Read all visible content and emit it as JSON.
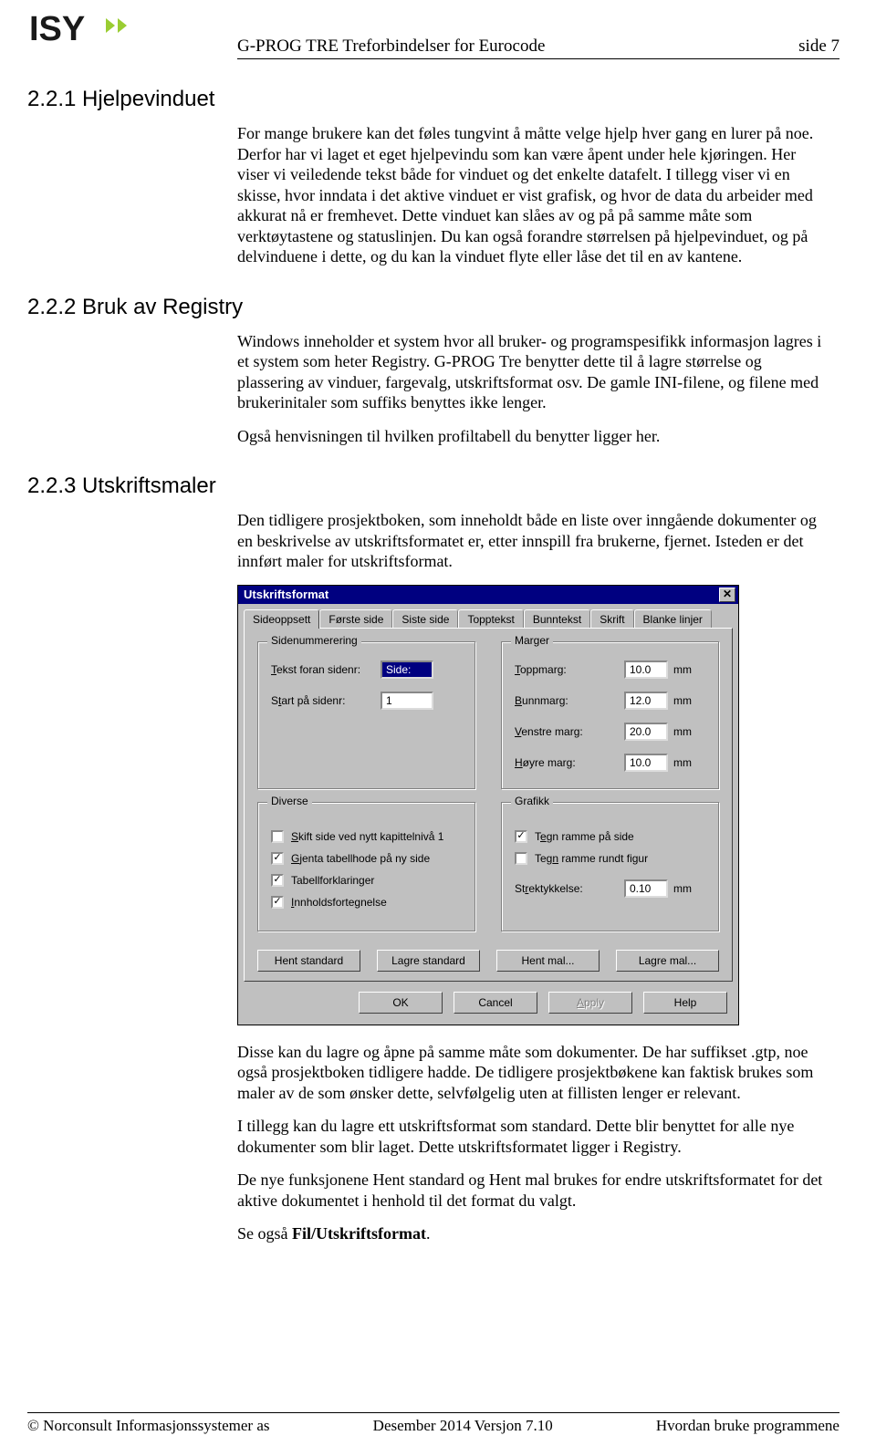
{
  "header": {
    "title": "G-PROG TRE Treforbindelser for Eurocode",
    "page": "side 7"
  },
  "sections": {
    "s1": {
      "title": "2.2.1 Hjelpevinduet",
      "p1": "For mange brukere kan det føles tungvint å måtte velge hjelp hver gang en lurer på noe. Derfor har vi laget et eget hjelpevindu som kan være åpent under hele kjøringen. Her viser vi veiledende tekst både for vinduet og det enkelte datafelt. I tillegg viser vi en skisse, hvor inndata i det aktive vinduet er vist grafisk, og hvor de data du arbeider med akkurat nå er fremhevet. Dette vinduet kan slåes av og på på samme måte som verktøytastene og statuslinjen. Du kan også forandre størrelsen på hjelpevinduet, og på delvinduene i dette, og du kan la vinduet flyte eller låse det til en av kantene."
    },
    "s2": {
      "title": "2.2.2 Bruk av Registry",
      "p1": "Windows inneholder et system hvor all bruker- og programspesifikk informasjon lagres i et system som heter Registry. G-PROG Tre benytter dette til å lagre størrelse og plassering av vinduer, fargevalg, utskriftsformat osv. De gamle INI-filene, og filene med brukerinitaler som suffiks benyttes ikke lenger.",
      "p2": "Også henvisningen til hvilken profiltabell du benytter ligger her."
    },
    "s3": {
      "title": "2.2.3 Utskriftsmaler",
      "p1": "Den tidligere prosjektboken, som inneholdt både en liste over inngående dokumenter og en beskrivelse av utskriftsformatet er, etter innspill fra brukerne, fjernet. Isteden er det innført maler for utskriftsformat.",
      "p2": "Disse kan du lagre og åpne på samme måte som dokumenter. De har suffikset .gtp, noe også prosjektboken tidligere hadde. De tidligere prosjektbøkene kan faktisk brukes som maler av de som ønsker dette, selvfølgelig uten at fillisten lenger er relevant.",
      "p3": "I tillegg kan du lagre ett utskriftsformat som standard. Dette blir benyttet for alle nye dokumenter som blir laget. Dette utskriftsformatet ligger i Registry.",
      "p4": "De nye funksjonene Hent standard og Hent mal brukes for endre utskriftsformatet for det aktive dokumentet i henhold til det format du valgt.",
      "p5a": "Se også ",
      "p5b": "Fil/Utskriftsformat",
      "p5c": "."
    }
  },
  "dialog": {
    "title": "Utskriftsformat",
    "tabs": [
      "Sideoppsett",
      "Første side",
      "Siste side",
      "Topptekst",
      "Bunntekst",
      "Skrift",
      "Blanke linjer"
    ],
    "pagegroup": {
      "title": "Sidenummerering",
      "l1": "Tekst foran sidenr:",
      "v1": "Side:",
      "l2": "Start på sidenr:",
      "v2": "1"
    },
    "margingroup": {
      "title": "Marger",
      "l1": "Toppmarg:",
      "v1": "10.0",
      "l2": "Bunnmarg:",
      "v2": "12.0",
      "l3": "Venstre marg:",
      "v3": "20.0",
      "l4": "Høyre marg:",
      "v4": "10.0",
      "unit": "mm"
    },
    "divgroup": {
      "title": "Diverse",
      "c1": "Skift side ved nytt kapittelnivå 1",
      "c2": "Gjenta tabellhode på ny side",
      "c3": "Tabellforklaringer",
      "c4": "Innholdsfortegnelse"
    },
    "gfxgroup": {
      "title": "Grafikk",
      "c1": "Tegn ramme på side",
      "c2": "Tegn ramme rundt figur",
      "l3": "Strektykkelse:",
      "v3": "0.10"
    },
    "buttons": {
      "hentstd": "Hent standard",
      "lagrestd": "Lagre standard",
      "hentmal": "Hent mal...",
      "lagremal": "Lagre mal...",
      "ok": "OK",
      "cancel": "Cancel",
      "apply": "Apply",
      "help": "Help"
    }
  },
  "footer": {
    "left": "© Norconsult Informasjonssystemer as",
    "center": "Desember 2014 Versjon 7.10",
    "right": "Hvordan bruke programmene"
  }
}
